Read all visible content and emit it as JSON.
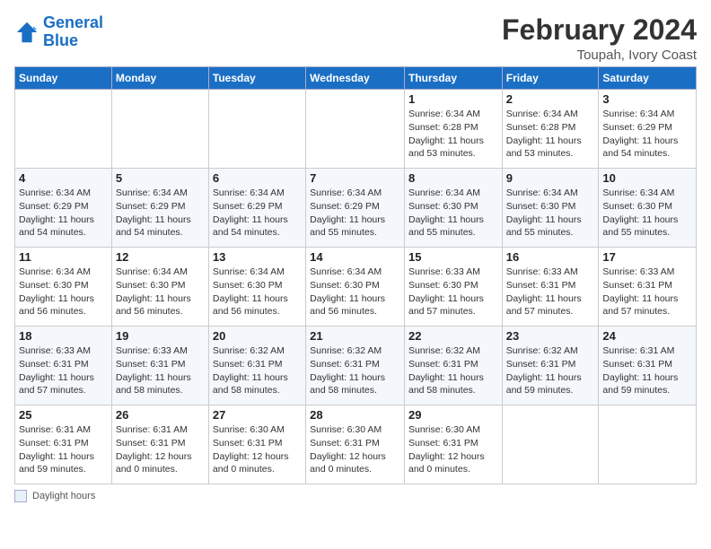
{
  "header": {
    "logo_line1": "General",
    "logo_line2": "Blue",
    "title": "February 2024",
    "subtitle": "Toupah, Ivory Coast"
  },
  "days_of_week": [
    "Sunday",
    "Monday",
    "Tuesday",
    "Wednesday",
    "Thursday",
    "Friday",
    "Saturday"
  ],
  "weeks": [
    [
      {
        "num": "",
        "info": ""
      },
      {
        "num": "",
        "info": ""
      },
      {
        "num": "",
        "info": ""
      },
      {
        "num": "",
        "info": ""
      },
      {
        "num": "1",
        "info": "Sunrise: 6:34 AM\nSunset: 6:28 PM\nDaylight: 11 hours and 53 minutes."
      },
      {
        "num": "2",
        "info": "Sunrise: 6:34 AM\nSunset: 6:28 PM\nDaylight: 11 hours and 53 minutes."
      },
      {
        "num": "3",
        "info": "Sunrise: 6:34 AM\nSunset: 6:29 PM\nDaylight: 11 hours and 54 minutes."
      }
    ],
    [
      {
        "num": "4",
        "info": "Sunrise: 6:34 AM\nSunset: 6:29 PM\nDaylight: 11 hours and 54 minutes."
      },
      {
        "num": "5",
        "info": "Sunrise: 6:34 AM\nSunset: 6:29 PM\nDaylight: 11 hours and 54 minutes."
      },
      {
        "num": "6",
        "info": "Sunrise: 6:34 AM\nSunset: 6:29 PM\nDaylight: 11 hours and 54 minutes."
      },
      {
        "num": "7",
        "info": "Sunrise: 6:34 AM\nSunset: 6:29 PM\nDaylight: 11 hours and 55 minutes."
      },
      {
        "num": "8",
        "info": "Sunrise: 6:34 AM\nSunset: 6:30 PM\nDaylight: 11 hours and 55 minutes."
      },
      {
        "num": "9",
        "info": "Sunrise: 6:34 AM\nSunset: 6:30 PM\nDaylight: 11 hours and 55 minutes."
      },
      {
        "num": "10",
        "info": "Sunrise: 6:34 AM\nSunset: 6:30 PM\nDaylight: 11 hours and 55 minutes."
      }
    ],
    [
      {
        "num": "11",
        "info": "Sunrise: 6:34 AM\nSunset: 6:30 PM\nDaylight: 11 hours and 56 minutes."
      },
      {
        "num": "12",
        "info": "Sunrise: 6:34 AM\nSunset: 6:30 PM\nDaylight: 11 hours and 56 minutes."
      },
      {
        "num": "13",
        "info": "Sunrise: 6:34 AM\nSunset: 6:30 PM\nDaylight: 11 hours and 56 minutes."
      },
      {
        "num": "14",
        "info": "Sunrise: 6:34 AM\nSunset: 6:30 PM\nDaylight: 11 hours and 56 minutes."
      },
      {
        "num": "15",
        "info": "Sunrise: 6:33 AM\nSunset: 6:30 PM\nDaylight: 11 hours and 57 minutes."
      },
      {
        "num": "16",
        "info": "Sunrise: 6:33 AM\nSunset: 6:31 PM\nDaylight: 11 hours and 57 minutes."
      },
      {
        "num": "17",
        "info": "Sunrise: 6:33 AM\nSunset: 6:31 PM\nDaylight: 11 hours and 57 minutes."
      }
    ],
    [
      {
        "num": "18",
        "info": "Sunrise: 6:33 AM\nSunset: 6:31 PM\nDaylight: 11 hours and 57 minutes."
      },
      {
        "num": "19",
        "info": "Sunrise: 6:33 AM\nSunset: 6:31 PM\nDaylight: 11 hours and 58 minutes."
      },
      {
        "num": "20",
        "info": "Sunrise: 6:32 AM\nSunset: 6:31 PM\nDaylight: 11 hours and 58 minutes."
      },
      {
        "num": "21",
        "info": "Sunrise: 6:32 AM\nSunset: 6:31 PM\nDaylight: 11 hours and 58 minutes."
      },
      {
        "num": "22",
        "info": "Sunrise: 6:32 AM\nSunset: 6:31 PM\nDaylight: 11 hours and 58 minutes."
      },
      {
        "num": "23",
        "info": "Sunrise: 6:32 AM\nSunset: 6:31 PM\nDaylight: 11 hours and 59 minutes."
      },
      {
        "num": "24",
        "info": "Sunrise: 6:31 AM\nSunset: 6:31 PM\nDaylight: 11 hours and 59 minutes."
      }
    ],
    [
      {
        "num": "25",
        "info": "Sunrise: 6:31 AM\nSunset: 6:31 PM\nDaylight: 11 hours and 59 minutes."
      },
      {
        "num": "26",
        "info": "Sunrise: 6:31 AM\nSunset: 6:31 PM\nDaylight: 12 hours and 0 minutes."
      },
      {
        "num": "27",
        "info": "Sunrise: 6:30 AM\nSunset: 6:31 PM\nDaylight: 12 hours and 0 minutes."
      },
      {
        "num": "28",
        "info": "Sunrise: 6:30 AM\nSunset: 6:31 PM\nDaylight: 12 hours and 0 minutes."
      },
      {
        "num": "29",
        "info": "Sunrise: 6:30 AM\nSunset: 6:31 PM\nDaylight: 12 hours and 0 minutes."
      },
      {
        "num": "",
        "info": ""
      },
      {
        "num": "",
        "info": ""
      }
    ]
  ],
  "footer": {
    "box_label": "Daylight hours"
  }
}
